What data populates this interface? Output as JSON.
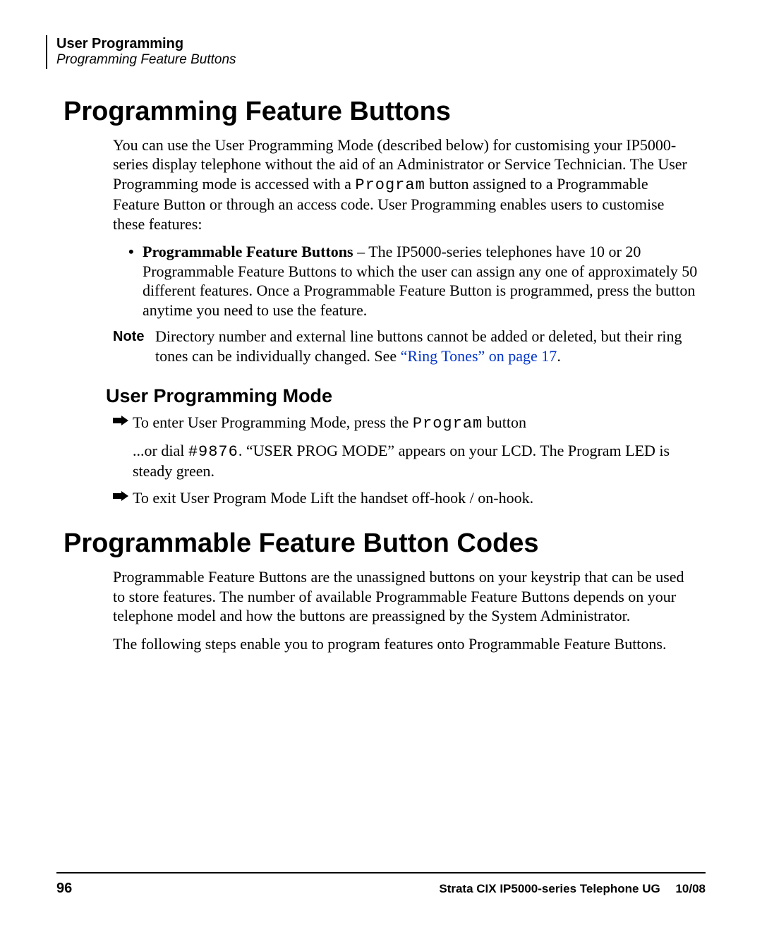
{
  "header": {
    "line1": "User Programming",
    "line2": "Programming Feature Buttons"
  },
  "sections": {
    "s1": {
      "title": "Programming Feature Buttons",
      "intro_part1": "You can use the User Programming Mode (described below) for customising your IP5000-series display telephone without the aid of an Administrator or Service Technician. The User Programming mode is accessed with a ",
      "intro_code": "Program",
      "intro_part2": " button assigned to a Programmable Feature Button or through an access code. User Programming enables users to customise these features:",
      "bullet": {
        "lead": "Programmable Feature Buttons",
        "rest": " – The IP5000-series telephones have 10 or 20 Programmable Feature Buttons to which the user can assign any one of approximately 50 different features. Once a Programmable Feature Button is programmed, press the button anytime you need to use the feature."
      },
      "note": {
        "label": "Note",
        "part1": "Directory number and external line buttons cannot be added or deleted, but their ring tones can be individually changed. See ",
        "link": "“Ring Tones” on page 17",
        "part2": "."
      }
    },
    "s1sub": {
      "title": "User Programming Mode",
      "step1_part1": "To enter User Programming Mode, press the ",
      "step1_code": "Program",
      "step1_part2": " button",
      "step1_cont_part1": "...or dial ",
      "step1_cont_code": "#9876",
      "step1_cont_part2": ". “USER PROG MODE” appears on your LCD. The Program LED is steady green.",
      "step2": "To exit User Program Mode Lift the handset off-hook / on-hook."
    },
    "s2": {
      "title": "Programmable Feature Button Codes",
      "p1": "Programmable Feature Buttons are the unassigned buttons on your keystrip that can be used to store features. The number of available Programmable Feature Buttons depends on your telephone model and how the buttons are preassigned by the System Administrator.",
      "p2": "The following steps enable you to program features onto Programmable Feature Buttons."
    }
  },
  "footer": {
    "page": "96",
    "doc": "Strata CIX IP5000-series Telephone UG  10/08"
  }
}
